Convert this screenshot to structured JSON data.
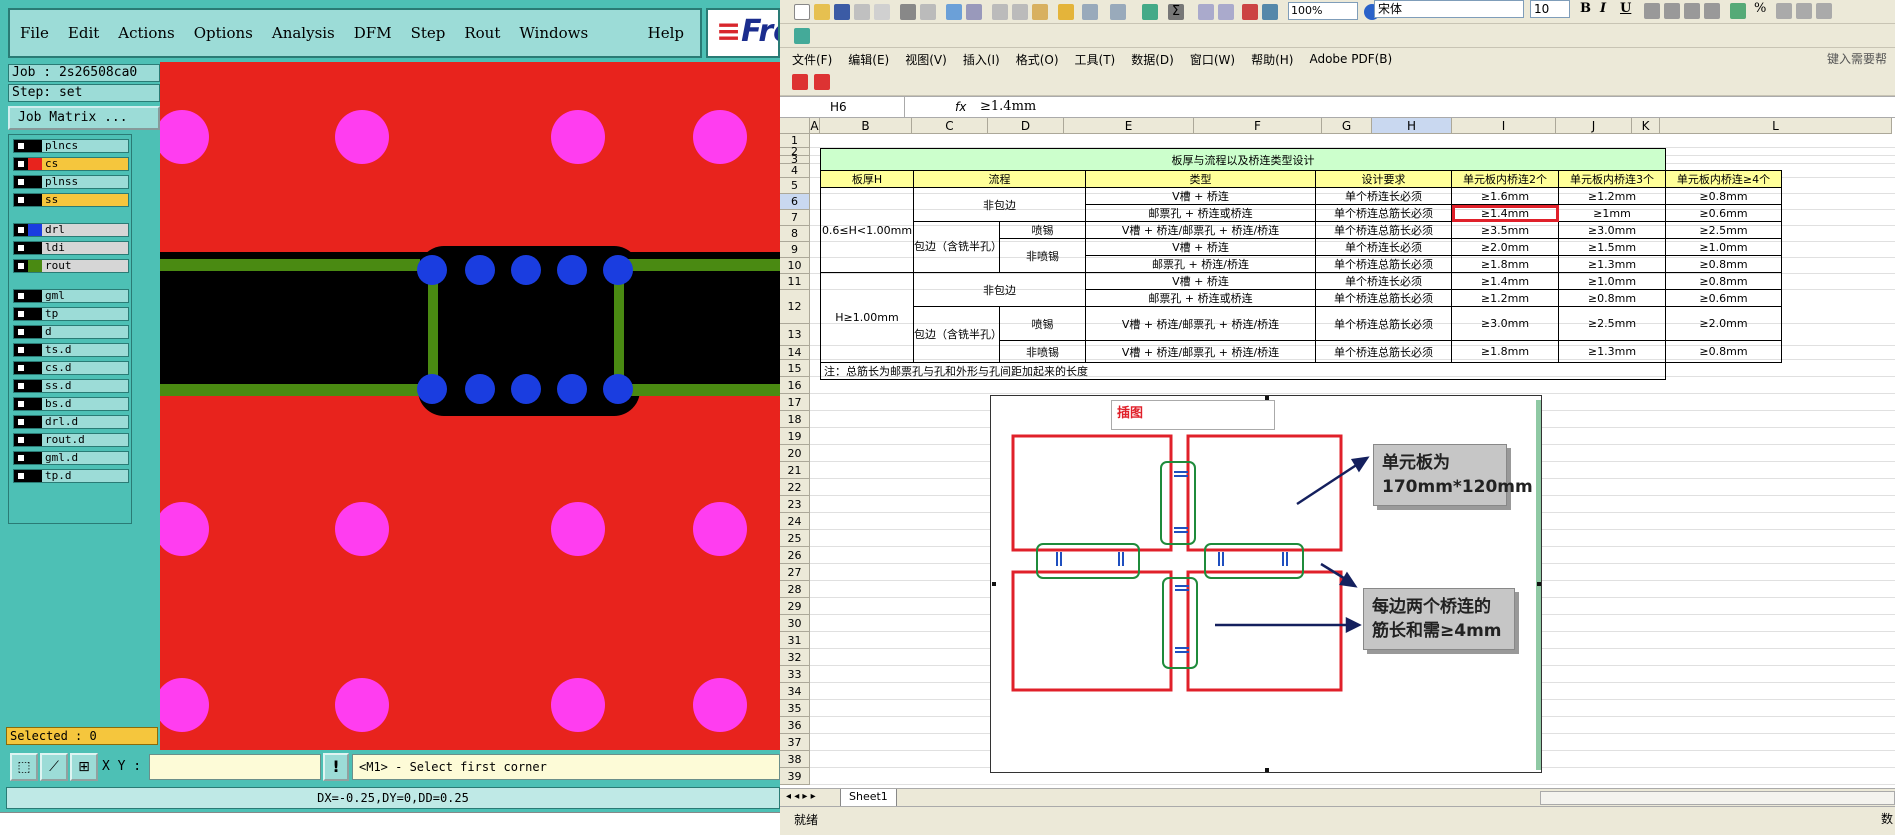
{
  "cam": {
    "menu": [
      "File",
      "Edit",
      "Actions",
      "Options",
      "Analysis",
      "DFM",
      "Step",
      "Rout",
      "Windows"
    ],
    "help": "Help",
    "logo": "Fro",
    "job": "Job : 2s26508ca0",
    "step": "Step: set",
    "job_matrix": "Job Matrix ...",
    "layers": [
      {
        "name": "plncs",
        "color": "#000000",
        "bg": "#9cdcd7"
      },
      {
        "name": "cs",
        "color": "#e8231d",
        "bg": "#f5c63d"
      },
      {
        "name": "plnss",
        "color": "#000000",
        "bg": "#9cdcd7"
      },
      {
        "name": "ss",
        "color": "#000000",
        "bg": "#f5c63d"
      },
      {
        "name": "drl",
        "color": "#1a3de0",
        "bg": "#d6d6d6"
      },
      {
        "name": "ldi",
        "color": "#000000",
        "bg": "#d6d6d6"
      },
      {
        "name": "rout",
        "color": "#4a8a12",
        "bg": "#d6d6d6"
      },
      {
        "name": "gml",
        "color": "#000000",
        "bg": "#9cdcd7"
      },
      {
        "name": "tp",
        "color": "#000000",
        "bg": "#9cdcd7"
      },
      {
        "name": "d",
        "color": "#000000",
        "bg": "#9cdcd7"
      },
      {
        "name": "ts.d",
        "color": "#000000",
        "bg": "#9cdcd7"
      },
      {
        "name": "cs.d",
        "color": "#000000",
        "bg": "#9cdcd7"
      },
      {
        "name": "ss.d",
        "color": "#000000",
        "bg": "#9cdcd7"
      },
      {
        "name": "bs.d",
        "color": "#000000",
        "bg": "#9cdcd7"
      },
      {
        "name": "drl.d",
        "color": "#000000",
        "bg": "#9cdcd7"
      },
      {
        "name": "rout.d",
        "color": "#000000",
        "bg": "#9cdcd7"
      },
      {
        "name": "gml.d",
        "color": "#000000",
        "bg": "#9cdcd7"
      },
      {
        "name": "tp.d",
        "color": "#000000",
        "bg": "#9cdcd7"
      }
    ],
    "selected": "Selected : 0",
    "xy_label": "X Y :",
    "xy_value": "",
    "warn": "!",
    "message": "<M1> - Select first corner",
    "status": "DX=-0.25,DY=0,DD=0.25",
    "colors": {
      "board": "#e8231d",
      "pad": "#ff3df0",
      "track": "#000000",
      "rout": "#4a8a12",
      "drill": "#1a3de0"
    }
  },
  "excel": {
    "font_name": "宋体",
    "font_size": "10",
    "zoom": "100%",
    "menu": [
      "文件(F)",
      "编辑(E)",
      "视图(V)",
      "插入(I)",
      "格式(O)",
      "工具(T)",
      "数据(D)",
      "窗口(W)",
      "帮助(H)",
      "Adobe PDF(B)"
    ],
    "help_hint": "键入需要帮",
    "name_box": "H6",
    "fx": "fx",
    "formula": "≥1.4mm",
    "columns": [
      "A",
      "B",
      "C",
      "D",
      "E",
      "F",
      "G",
      "H",
      "I",
      "J",
      "K",
      "L"
    ],
    "rows": [
      "1",
      "2",
      "3",
      "4",
      "5",
      "6",
      "7",
      "8",
      "9",
      "10",
      "11",
      "12",
      "13",
      "14",
      "15",
      "16",
      "17",
      "18",
      "19",
      "20",
      "21",
      "22",
      "23",
      "24",
      "25",
      "26",
      "27",
      "28",
      "29",
      "30",
      "31",
      "32",
      "33",
      "34",
      "35",
      "36",
      "37",
      "38",
      "39"
    ],
    "table": {
      "title": "板厚与流程以及桥连类型设计",
      "headers": [
        "板厚H",
        "流程",
        "类型",
        "设计要求",
        "单元板内桥连2个",
        "单元板内桥连3个",
        "单元板内桥连≥4个"
      ],
      "group1_thickness": "0.6≤H<1.00mm",
      "group2_thickness": "H≥1.00mm",
      "non_wrap": "非包边",
      "wrap": "包边（含铣半孔）",
      "spray": "喷锡",
      "non_spray": "非喷锡",
      "rows": [
        [
          "V槽 + 桥连",
          "单个桥连长必须",
          "≥1.6mm",
          "≥1.2mm",
          "≥0.8mm"
        ],
        [
          "邮票孔 + 桥连或桥连",
          "单个桥连总筋长必须",
          "≥1.4mm",
          "≥1mm",
          "≥0.6mm"
        ],
        [
          "V槽 + 桥连/邮票孔 + 桥连/桥连",
          "单个桥连总筋长必须",
          "≥3.5mm",
          "≥3.0mm",
          "≥2.5mm"
        ],
        [
          "V槽 + 桥连",
          "单个桥连长必须",
          "≥2.0mm",
          "≥1.5mm",
          "≥1.0mm"
        ],
        [
          "邮票孔 + 桥连/桥连",
          "单个桥连总筋长必须",
          "≥1.8mm",
          "≥1.3mm",
          "≥0.8mm"
        ],
        [
          "V槽 + 桥连",
          "单个桥连长必须",
          "≥1.4mm",
          "≥1.0mm",
          "≥0.8mm"
        ],
        [
          "邮票孔 + 桥连或桥连",
          "单个桥连总筋长必须",
          "≥1.2mm",
          "≥0.8mm",
          "≥0.6mm"
        ],
        [
          "V槽 + 桥连/邮票孔 + 桥连/桥连",
          "单个桥连总筋长必须",
          "≥3.0mm",
          "≥2.5mm",
          "≥2.0mm"
        ],
        [
          "V槽 + 桥连/邮票孔 + 桥连/桥连",
          "单个桥连总筋长必须",
          "≥1.8mm",
          "≥1.3mm",
          "≥0.8mm"
        ]
      ],
      "note": "注：总筋长为邮票孔与孔和外形与孔间距加起来的长度"
    },
    "picture": {
      "title": "插图",
      "callout1": "单元板为 170mm*120mm",
      "callout2": "每边两个桥连的 筋长和需≥4mm"
    },
    "sheet_tab": "Sheet1",
    "status": "就绪",
    "status_right": "数"
  }
}
